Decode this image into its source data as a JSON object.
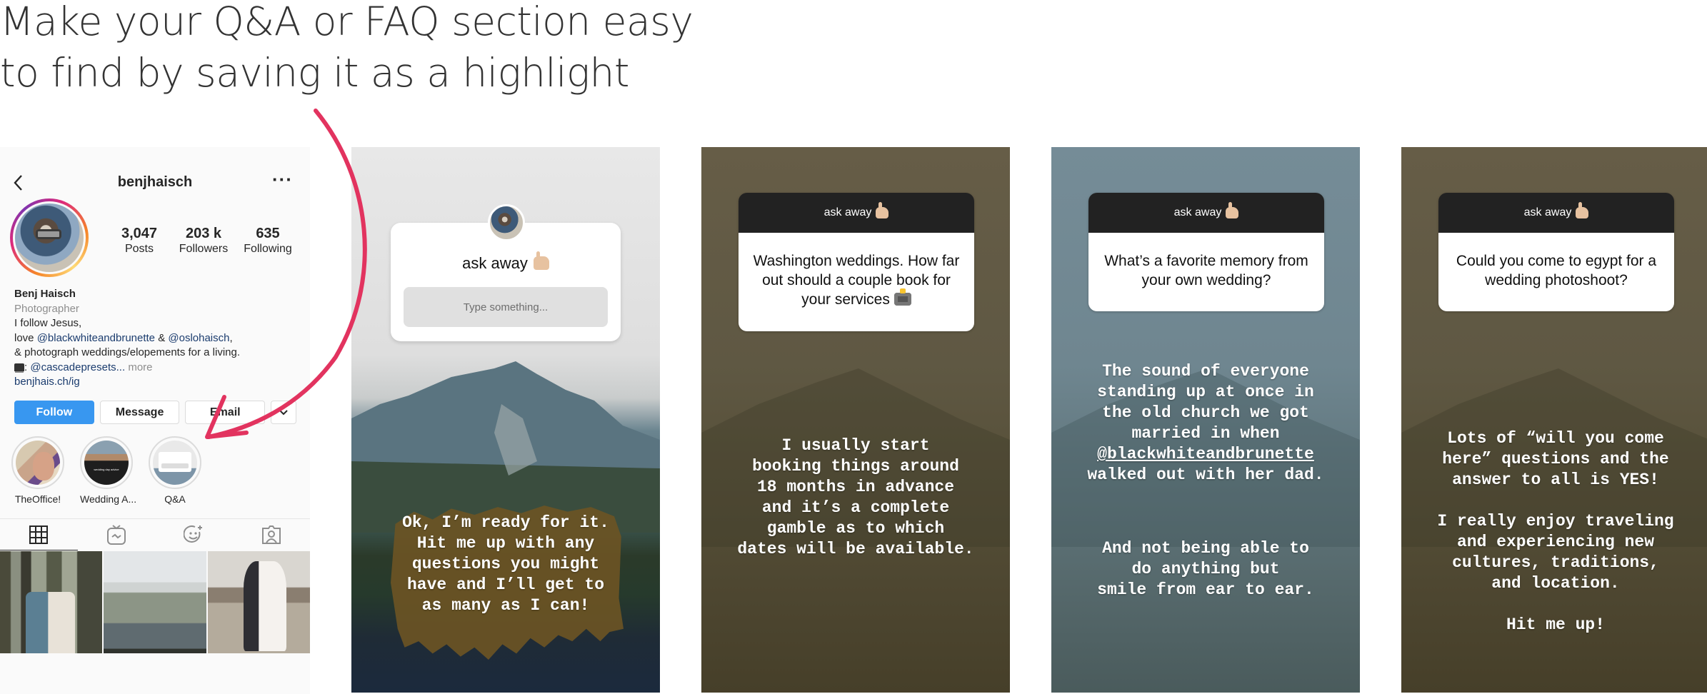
{
  "headline": {
    "line1": "Make your Q&A or FAQ section easy",
    "line2": "to find by saving it as a highlight"
  },
  "annotation": {
    "color": "#e2335f",
    "icon": "curved-arrow-icon"
  },
  "profile": {
    "username": "benjhaisch",
    "back_icon": "chevron-left-icon",
    "more_icon": "ellipsis-icon",
    "stats": [
      {
        "value": "3,047",
        "label": "Posts"
      },
      {
        "value": "203 k",
        "label": "Followers"
      },
      {
        "value": "635",
        "label": "Following"
      }
    ],
    "bio": {
      "name": "Benj Haisch",
      "category": "Photographer",
      "line1": "I follow Jesus,",
      "line2_prefix": "love ",
      "line2_link1": "@blackwhiteandbrunette",
      "line2_mid": " & ",
      "line2_link2": "@oslohaisch",
      "line2_suffix": ",",
      "line3": "& photograph weddings/elopements for a living.",
      "line4_sep": ": ",
      "line4_link": "@cascadepresets",
      "line4_ellipsis": "...",
      "line4_more": " more",
      "website": "benjhais.ch/ig"
    },
    "buttons": {
      "follow": "Follow",
      "message": "Message",
      "email": "Email",
      "dropdown": "⌄"
    },
    "highlights": [
      {
        "label": "TheOffice!"
      },
      {
        "label": "Wedding A..."
      },
      {
        "label": "Q&A"
      }
    ],
    "tabs": [
      {
        "icon": "grid-icon",
        "active": true
      },
      {
        "icon": "igtv-icon",
        "active": false
      },
      {
        "icon": "effects-icon",
        "active": false
      },
      {
        "icon": "tagged-icon",
        "active": false
      }
    ],
    "follow_color": "#3897f0"
  },
  "stories": [
    {
      "sticker_title": "ask away",
      "sticker_placeholder": "Type something...",
      "answer": "Ok, I’m ready for it.\nHit me up with any\nquestions you might\nhave and I’ll get to\nas many as I can!"
    },
    {
      "sticker_title": "ask away",
      "question": "Washington weddings. How far out should a couple book for your services",
      "answer": "I usually start\nbooking things around\n18 months in advance\nand it’s a complete\ngamble as to which\ndates will be available."
    },
    {
      "sticker_title": "ask away",
      "question": "What’s a favorite memory from your own wedding?",
      "answer_part1_pre": "The sound of everyone\nstanding up at once in\nthe old church we got\nmarried in when\n",
      "answer_mention": "@blackwhiteandbrunette",
      "answer_part1_post": "\nwalked out with her dad.",
      "answer_part2": "And not being able to\ndo anything but\nsmile from ear to ear."
    },
    {
      "sticker_title": "ask away",
      "question": "Could you come to egypt for a wedding photoshoot?",
      "answer": "Lots of “will you come\nhere” questions and the\nanswer to all is YES!\n\nI really enjoy traveling\nand experiencing new\ncultures, traditions,\nand location.\n\nHit me up!"
    }
  ]
}
